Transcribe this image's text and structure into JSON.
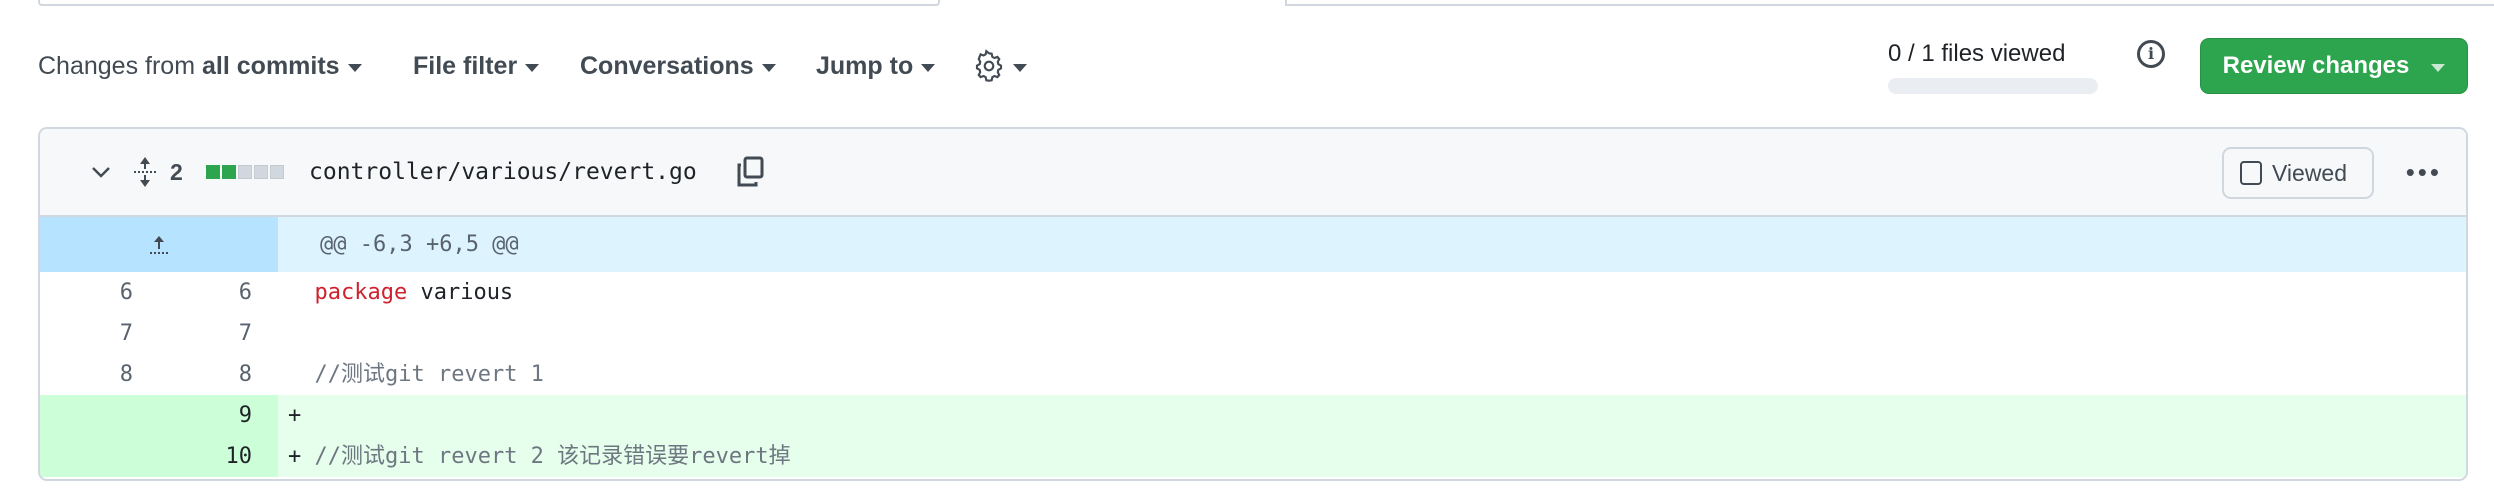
{
  "toolbar": {
    "changes_prefix": "Changes from",
    "changes_value": "all commits",
    "file_filter": "File filter",
    "conversations": "Conversations",
    "jump_to": "Jump to",
    "settings_icon": "gear-icon"
  },
  "progress": {
    "label": "0 / 1 files viewed",
    "fraction": 0
  },
  "review_button": "Review changes",
  "file": {
    "changes_count": "2",
    "diffstat": [
      "added",
      "added",
      "neutral",
      "neutral",
      "neutral"
    ],
    "path": "controller/various/revert.go",
    "viewed_label": "Viewed",
    "viewed_checked": false,
    "hunk_header": "@@ -6,3 +6,5 @@",
    "lines": [
      {
        "old": "6",
        "new": "6",
        "marker": " ",
        "keyword": "package",
        "text": " various",
        "type": "context"
      },
      {
        "old": "7",
        "new": "7",
        "marker": " ",
        "keyword": "",
        "text": "",
        "type": "context"
      },
      {
        "old": "8",
        "new": "8",
        "marker": " ",
        "keyword": "",
        "text": "//测试git revert 1",
        "type": "context"
      },
      {
        "old": "",
        "new": "9",
        "marker": "+",
        "keyword": "",
        "text": "",
        "type": "add"
      },
      {
        "old": "",
        "new": "10",
        "marker": "+",
        "keyword": "",
        "text": "//测试git revert 2 该记录错误要revert掉",
        "type": "add"
      }
    ]
  },
  "colors": {
    "accent_green": "#2da44e",
    "add_bg": "#e6ffec",
    "add_gutter": "#ccffd8",
    "hunk_bg": "#ddf4ff",
    "keyword": "#cf222e"
  }
}
